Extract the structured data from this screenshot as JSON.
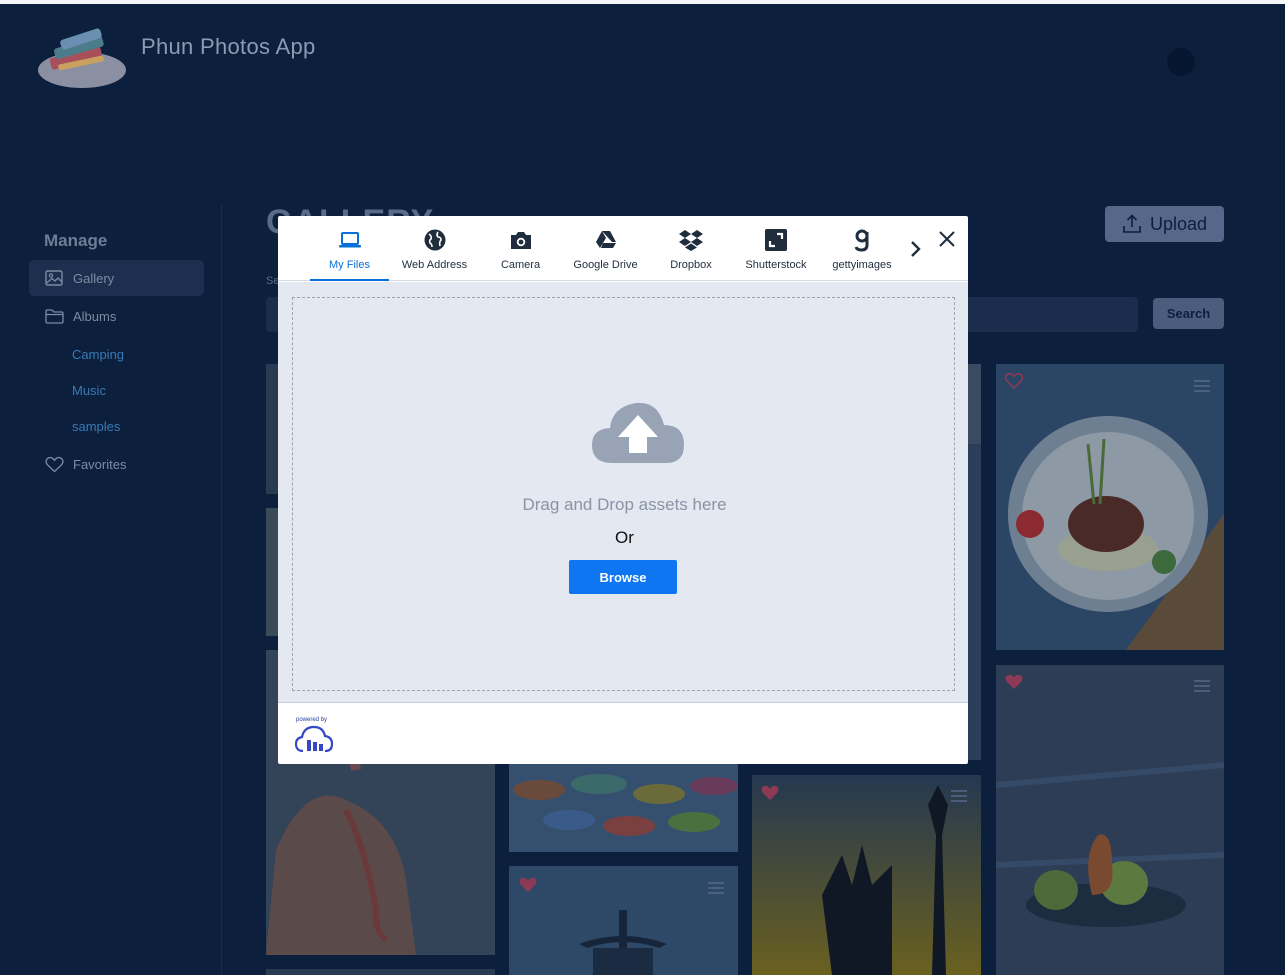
{
  "app": {
    "title": "Phun Photos App"
  },
  "sidebar": {
    "heading": "Manage",
    "items": [
      {
        "label": "Gallery",
        "icon": "image-icon",
        "active": true
      },
      {
        "label": "Albums",
        "icon": "folder-icon",
        "active": false
      },
      {
        "label": "Favorites",
        "icon": "heart-icon",
        "active": false
      }
    ],
    "albums": [
      "Camping",
      "Music",
      "samples"
    ]
  },
  "main": {
    "title": "GALLERY",
    "upload_label": "Upload",
    "search_label": "Se",
    "search_button": "Search"
  },
  "upload_widget": {
    "tabs": [
      {
        "label": "My Files",
        "icon": "laptop-icon",
        "active": true
      },
      {
        "label": "Web Address",
        "icon": "globe-icon",
        "active": false
      },
      {
        "label": "Camera",
        "icon": "camera-icon",
        "active": false
      },
      {
        "label": "Google Drive",
        "icon": "google-drive-icon",
        "active": false
      },
      {
        "label": "Dropbox",
        "icon": "dropbox-icon",
        "active": false
      },
      {
        "label": "Shutterstock",
        "icon": "shutterstock-icon",
        "active": false
      },
      {
        "label": "gettyimages",
        "icon": "gettyimages-icon",
        "active": false
      }
    ],
    "drop_text": "Drag and Drop assets here",
    "or_text": "Or",
    "browse_label": "Browse",
    "powered_by": "powered by",
    "accent_color": "#0e76f0"
  },
  "gallery": {
    "photos": [
      {
        "subject": "plated dish with flowers",
        "favorited": false
      },
      {
        "subject": "pears on wooden table",
        "favorited": true
      },
      {
        "subject": "silhouette sculpture at sunset",
        "favorited": true
      },
      {
        "subject": "pagoda in fog",
        "favorited": true
      },
      {
        "subject": "colorful umbrellas",
        "favorited": false
      },
      {
        "subject": "person with tattoo",
        "favorited": false
      }
    ]
  }
}
